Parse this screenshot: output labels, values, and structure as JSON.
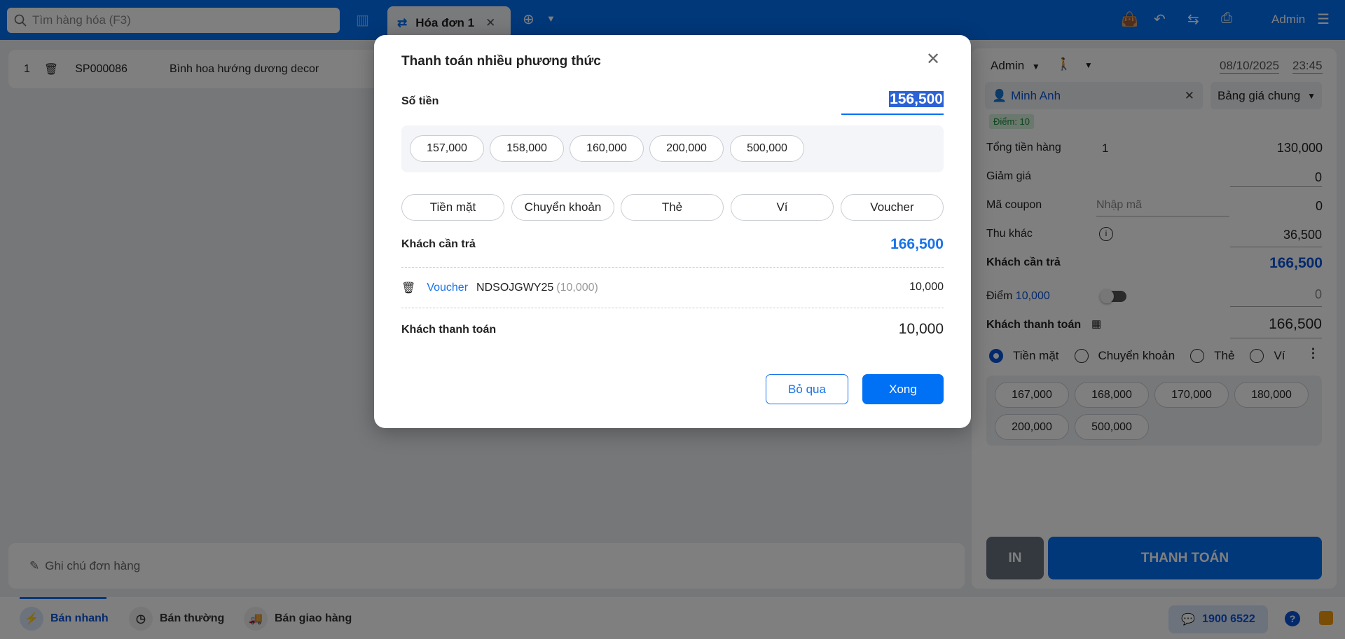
{
  "topbar": {
    "search_placeholder": "Tìm hàng hóa (F3)",
    "tab_label": "Hóa đơn 1",
    "user": "Admin"
  },
  "cart": {
    "items": [
      {
        "index": "1",
        "code": "SP000086",
        "name": "Bình hoa hướng dương decor"
      }
    ],
    "note_placeholder": "Ghi chú đơn hàng"
  },
  "panel": {
    "seller": "Admin",
    "date": "08/10/2025",
    "time": "23:45",
    "customer": "Minh Anh",
    "price_list": "Bảng giá chung",
    "points_badge": "Điểm: 10",
    "total_label": "Tổng tiền hàng",
    "total_qty": "1",
    "total_value": "130,000",
    "discount_label": "Giảm giá",
    "discount_value": "0",
    "coupon_label": "Mã coupon",
    "coupon_placeholder": "Nhập mã",
    "coupon_value": "0",
    "other_label": "Thu khác",
    "other_value": "36,500",
    "due_label": "Khách cần trả",
    "due_value": "166,500",
    "points_label": "Điểm",
    "points_value": "10,000",
    "points_amount": "0",
    "paid_label": "Khách thanh toán",
    "paid_value": "166,500",
    "methods": [
      "Tiền mặt",
      "Chuyển khoản",
      "Thẻ",
      "Ví"
    ],
    "suggestions": [
      "167,000",
      "168,000",
      "170,000",
      "180,000",
      "200,000",
      "500,000"
    ],
    "print_label": "IN",
    "pay_label": "THANH TOÁN"
  },
  "bottombar": {
    "modes": [
      "Bán nhanh",
      "Bán thường",
      "Bán giao hàng"
    ],
    "hotline": "1900 6522"
  },
  "modal": {
    "title": "Thanh toán nhiều phương thức",
    "amount_label": "Số tiền",
    "amount_value": "156,500",
    "suggestions": [
      "157,000",
      "158,000",
      "160,000",
      "200,000",
      "500,000"
    ],
    "methods": [
      "Tiền mặt",
      "Chuyển khoản",
      "Thẻ",
      "Ví",
      "Voucher"
    ],
    "due_label": "Khách cần trả",
    "due_value": "166,500",
    "voucher": {
      "type": "Voucher",
      "code": "NDSOJGWY25",
      "face": "(10,000)",
      "amount": "10,000"
    },
    "paid_label": "Khách thanh toán",
    "paid_value": "10,000",
    "cancel_label": "Bỏ qua",
    "done_label": "Xong"
  },
  "colors": {
    "brand": "#0070f4",
    "accent_text": "#1a73e8"
  }
}
